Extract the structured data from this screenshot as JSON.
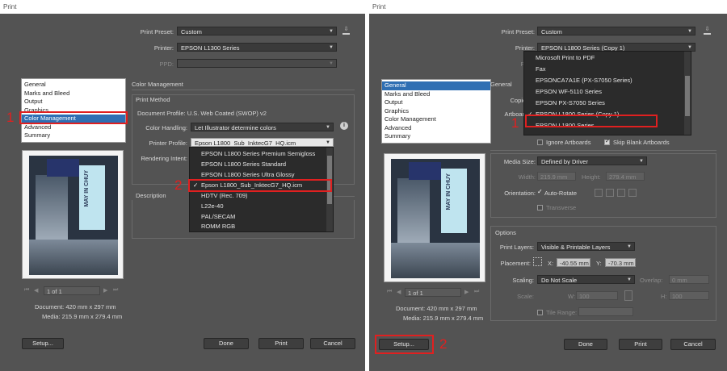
{
  "left": {
    "title": "Print",
    "preset_label": "Print Preset:",
    "preset_value": "Custom",
    "printer_label": "Printer:",
    "printer_value": "EPSON L1300 Series",
    "ppd_label": "PPD:",
    "nav": [
      "General",
      "Marks and Bleed",
      "Output",
      "Graphics",
      "Color Management",
      "Advanced",
      "Summary"
    ],
    "nav_selected_index": 4,
    "section_title": "Color Management",
    "print_method_title": "Print Method",
    "doc_profile": "Document Profile: U.S. Web Coated (SWOP) v2",
    "color_handling_label": "Color Handling:",
    "color_handling_value": "Let Illustrator determine colors",
    "printer_profile_label": "Printer Profile:",
    "printer_profile_value": "Epson L1800_Sub_InktecG7_HQ.icm",
    "rendering_intent_label": "Rendering Intent:",
    "profile_options": [
      "EPSON L1800 Series Premium Semigloss",
      "EPSON L1800 Series Standard",
      "EPSON L1800 Series Ultra Glossy",
      "Epson L1800_Sub_InktecG7_HQ.icm",
      "HDTV (Rec. 709)",
      "L22e-40",
      "PAL/SECAM",
      "ROMM RGB"
    ],
    "profile_checked_index": 3,
    "description_title": "Description",
    "page_nav": "1 of 1",
    "document_size": "Document: 420 mm x 297 mm",
    "media_size": "Media: 215.9 mm x 279.4 mm",
    "setup_label": "Setup...",
    "done_label": "Done",
    "print_label": "Print",
    "cancel_label": "Cancel",
    "marker1": "1",
    "marker2": "2",
    "preview_text": "MAY IN CHUY"
  },
  "right": {
    "title": "Print",
    "preset_label": "Print Preset:",
    "preset_value": "Custom",
    "printer_label": "Printer:",
    "printer_value": "EPSON L1800 Series (Copy 1)",
    "ppd_label": "PPD:",
    "nav": [
      "General",
      "Marks and Bleed",
      "Output",
      "Graphics",
      "Color Management",
      "Advanced",
      "Summary"
    ],
    "nav_selected_index": 0,
    "section_title": "General",
    "copies_label": "Copies:",
    "artboards_label": "Artboards",
    "printer_options": [
      "Microsoft Print to PDF",
      "Fax",
      "EPSONCA7A1E (PX-S7050 Series)",
      "EPSON WF-5110 Series",
      "EPSON PX-S7050 Series",
      "EPSON L1800 Series (Copy 1)",
      "EPSON L1800 Series"
    ],
    "printer_checked_index": 5,
    "ignore_artboards": "Ignore Artboards",
    "skip_blank": "Skip Blank Artboards",
    "media_size_label": "Media Size:",
    "media_size_value": "Defined by Driver",
    "width_label": "Width:",
    "width_value": "215.9 mm",
    "height_label": "Height:",
    "height_value": "279.4 mm",
    "orientation_label": "Orientation:",
    "auto_rotate": "Auto-Rotate",
    "transverse": "Transverse",
    "options_title": "Options",
    "print_layers_label": "Print Layers:",
    "print_layers_value": "Visible & Printable Layers",
    "placement_label": "Placement:",
    "x_label": "X:",
    "x_value": "-40.55 mm",
    "y_label": "Y:",
    "y_value": "-70.3 mm",
    "scaling_label": "Scaling:",
    "scaling_value": "Do Not Scale",
    "overlap_label": "Overlap:",
    "overlap_value": "0 mm",
    "scale_label": "Scale:",
    "w_label": "W:",
    "w_value": "100",
    "h_label": "H:",
    "h_value": "100",
    "tile_range": "Tile Range:",
    "page_nav": "1 of 1",
    "document_size": "Document: 420 mm x 297 mm",
    "media_size": "Media: 215.9 mm x 279.4 mm",
    "setup_label": "Setup...",
    "done_label": "Done",
    "print_label": "Print",
    "cancel_label": "Cancel",
    "marker1": "1",
    "marker2": "2",
    "preview_text": "MAY IN CHUY"
  }
}
